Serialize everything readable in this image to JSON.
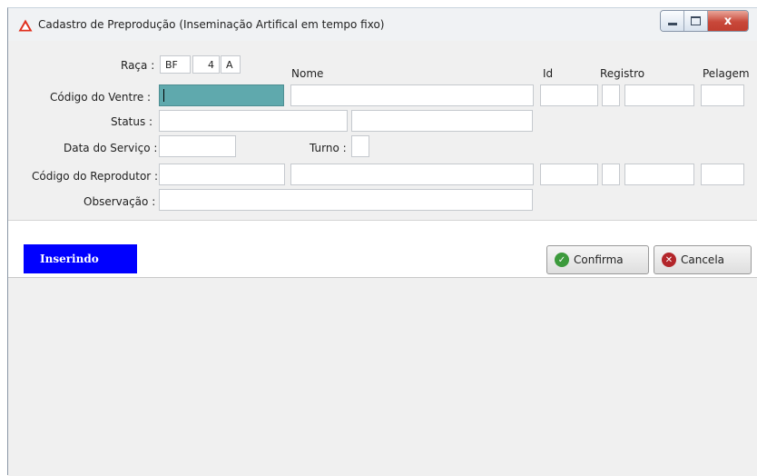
{
  "window": {
    "title": "Cadastro de Preprodução (Inseminação Artifical em tempo fixo)",
    "icon": "warning-triangle-icon",
    "accent": "#e0301e"
  },
  "caption_buttons": {
    "minimize": "minimize-icon",
    "maximize": "maximize-icon",
    "close": "x"
  },
  "form": {
    "raca": {
      "label": "Raça :",
      "code": "BF",
      "number": "4",
      "letter": "A"
    },
    "headers": {
      "nome": "Nome",
      "id": "Id",
      "registro": "Registro",
      "pelagem": "Pelagem"
    },
    "codigo_ventre": {
      "label": "Código do Ventre :",
      "value": "",
      "nome": "",
      "id": "",
      "flag": "",
      "registro": "",
      "pelagem": ""
    },
    "status": {
      "label": "Status :",
      "value": "",
      "value2": ""
    },
    "data_servico": {
      "label": "Data do Serviço :",
      "value": ""
    },
    "turno": {
      "label": "Turno :",
      "value": ""
    },
    "codigo_reprodutor": {
      "label": "Código do Reprodutor :",
      "value": "",
      "nome": "",
      "id": "",
      "flag": "",
      "registro": "",
      "pelagem": ""
    },
    "observacao": {
      "label": "Observação :",
      "value": ""
    }
  },
  "actionbar": {
    "mode": "Inserindo",
    "mode_color": "#0000ff",
    "confirm_label": "Confirma",
    "cancel_label": "Cancela"
  }
}
